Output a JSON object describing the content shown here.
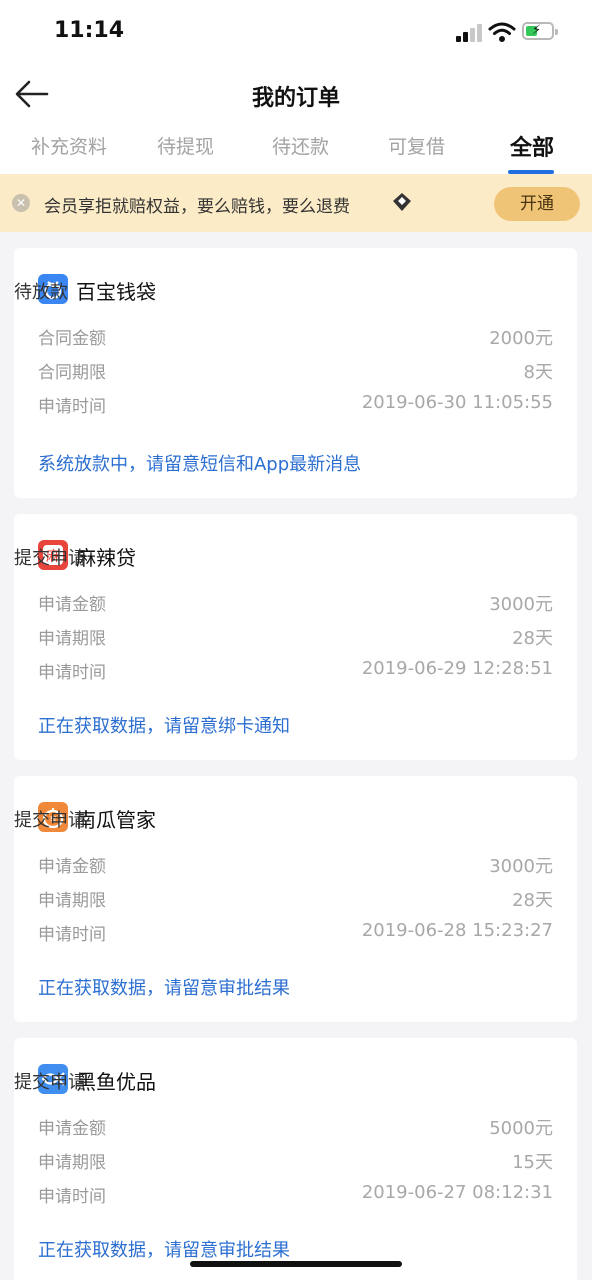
{
  "status_bar": {
    "time": "11:14"
  },
  "nav": {
    "title": "我的订单"
  },
  "tabs": [
    {
      "label": "补充资料",
      "active": false
    },
    {
      "label": "待提现",
      "active": false
    },
    {
      "label": "待还款",
      "active": false
    },
    {
      "label": "可复借",
      "active": false
    },
    {
      "label": "全部",
      "active": true
    }
  ],
  "banner": {
    "text": "会员享拒就赔权益，要么赔钱，要么退费",
    "button": "开通"
  },
  "orders": [
    {
      "name": "百宝钱袋",
      "status": "待放款",
      "logo_color": "#3a86f2",
      "logo_glyph": "钱",
      "rows": [
        {
          "label": "合同金额",
          "value": "2000元"
        },
        {
          "label": "合同期限",
          "value": "8天"
        },
        {
          "label": "申请时间",
          "value": "2019-06-30 11:05:55"
        }
      ],
      "note": "系统放款中，请留意短信和App最新消息"
    },
    {
      "name": "麻辣贷",
      "status": "提交申请",
      "logo_color": "#e8453c",
      "logo_glyph": "麻",
      "rows": [
        {
          "label": "申请金额",
          "value": "3000元"
        },
        {
          "label": "申请期限",
          "value": "28天"
        },
        {
          "label": "申请时间",
          "value": "2019-06-29 12:28:51"
        }
      ],
      "note": "正在获取数据，请留意绑卡通知"
    },
    {
      "name": "南瓜管家",
      "status": "提交申请",
      "logo_color": "#f08a3a",
      "logo_glyph": "¥",
      "rows": [
        {
          "label": "申请金额",
          "value": "3000元"
        },
        {
          "label": "申请期限",
          "value": "28天"
        },
        {
          "label": "申请时间",
          "value": "2019-06-28 15:23:27"
        }
      ],
      "note": "正在获取数据，请留意审批结果"
    },
    {
      "name": "黑鱼优品",
      "status": "提交申请",
      "logo_color": "#3f8ef0",
      "logo_glyph": "",
      "rows": [
        {
          "label": "申请金额",
          "value": "5000元"
        },
        {
          "label": "申请期限",
          "value": "15天"
        },
        {
          "label": "申请时间",
          "value": "2019-06-27 08:12:31"
        }
      ],
      "note": "正在获取数据，请留意审批结果"
    }
  ]
}
